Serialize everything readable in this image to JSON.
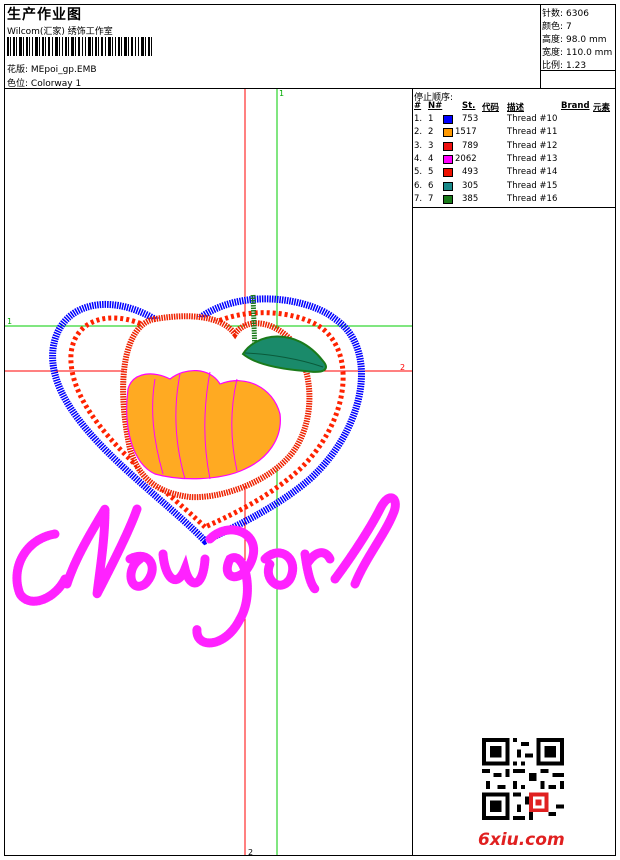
{
  "header": {
    "title": "生产作业图",
    "studio": "Wilcom(汇家) 绣饰工作室",
    "design_label": "花版:",
    "design_value": "MEpoi_gp.EMB",
    "color_label": "色位:",
    "color_value": "Colorway 1"
  },
  "info": [
    {
      "label": "针数:",
      "value": "6306"
    },
    {
      "label": "颜色:",
      "value": "7"
    },
    {
      "label": "高度:",
      "value": "98.0 mm"
    },
    {
      "label": "宽度:",
      "value": "110.0 mm"
    },
    {
      "label": "比例:",
      "value": "1.23"
    }
  ],
  "stop_sequence": {
    "title": "停止顺序:",
    "headers": {
      "idx": "#",
      "no": "N#",
      "st": "St.",
      "code": "代码",
      "desc": "描述",
      "brand": "Brand",
      "elem": "元素"
    },
    "rows": [
      {
        "idx": "1.",
        "no": "1",
        "color": "#0000ff",
        "st": "753",
        "desc": "Thread #10"
      },
      {
        "idx": "2.",
        "no": "2",
        "color": "#ff9900",
        "st": "1517",
        "desc": "Thread #11"
      },
      {
        "idx": "3.",
        "no": "3",
        "color": "#ee1111",
        "st": "789",
        "desc": "Thread #12"
      },
      {
        "idx": "4.",
        "no": "4",
        "color": "#ff00ff",
        "st": "2062",
        "desc": "Thread #13"
      },
      {
        "idx": "5.",
        "no": "5",
        "color": "#ee1100",
        "st": "493",
        "desc": "Thread #14"
      },
      {
        "idx": "6.",
        "no": "6",
        "color": "#1a8a8a",
        "st": "305",
        "desc": "Thread #15"
      },
      {
        "idx": "7.",
        "no": "7",
        "color": "#1a7a1a",
        "st": "385",
        "desc": "Thread #16"
      }
    ]
  },
  "canvas": {
    "marker_top": "1",
    "marker_left": "1",
    "marker_right": "2",
    "marker_bottom": "2",
    "lettering": "Newpoi"
  },
  "watermark": "6xiu.com",
  "colors": {
    "guide_red": "#ff0000",
    "guide_green": "#00cc00",
    "heart_blue": "#0000ff",
    "text_magenta": "#ff22ff",
    "apple_red": "#ee2200",
    "fruit_orange": "#ffaa22",
    "leaf": "#1a8a6a"
  }
}
